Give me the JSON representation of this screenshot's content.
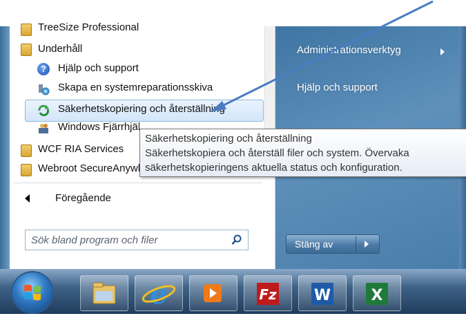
{
  "program_list": {
    "items": [
      {
        "label": "TreeSize Professional"
      },
      {
        "label": "Underhåll"
      },
      {
        "label": "Hjälp och support"
      },
      {
        "label": "Skapa en systemreparationsskiva"
      },
      {
        "label": "Säkerhetskopiering och återställning"
      },
      {
        "label": "Windows Fjärrhjälp"
      },
      {
        "label": "WCF RIA Services"
      },
      {
        "label": "Webroot SecureAnywhere"
      }
    ],
    "back_label": "Föregående"
  },
  "search": {
    "placeholder": "Sök bland program och filer"
  },
  "right_pane": {
    "items": [
      {
        "label": "Administrationsverktyg"
      },
      {
        "label": "Hjälp och support"
      }
    ],
    "shutdown_label": "Stäng av"
  },
  "tooltip": {
    "title": "Säkerhetskopiering och återställning",
    "line1": "Säkerhetskopiera och återställ filer och system. Övervaka",
    "line2": "säkerhetskopieringens aktuella status och konfiguration."
  },
  "taskbar": {
    "apps": [
      {
        "icon": "file-explorer-icon"
      },
      {
        "icon": "internet-explorer-icon"
      },
      {
        "icon": "media-player-icon"
      },
      {
        "icon": "filezilla-icon"
      },
      {
        "icon": "word-icon"
      },
      {
        "icon": "excel-icon"
      }
    ]
  },
  "colors": {
    "annotation_arrow": "#4a7cc0",
    "right_pane": "#4a7eaa"
  }
}
